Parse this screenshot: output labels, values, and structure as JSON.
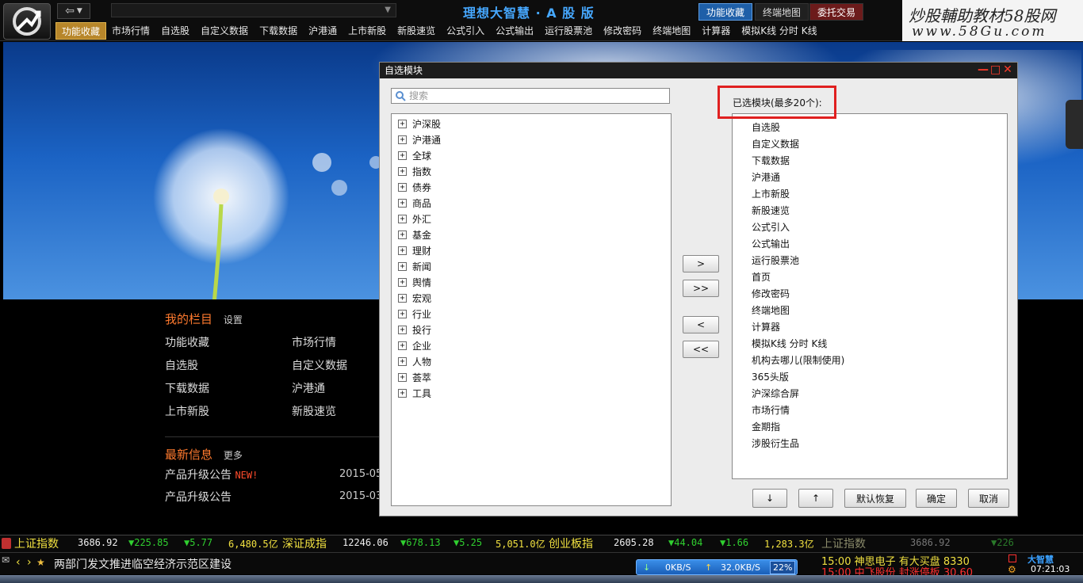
{
  "app": {
    "title": "理想大智慧 · A 股 版",
    "top_tabs": [
      "功能收藏",
      "终端地图",
      "委托交易"
    ]
  },
  "ad": {
    "line1": "炒股輔助教材58股网",
    "line2": "www.58Gu.com"
  },
  "menu": [
    "功能收藏",
    "市场行情",
    "自选股",
    "自定义数据",
    "下载数据",
    "沪港通",
    "上市新股",
    "新股速览",
    "公式引入",
    "公式输出",
    "运行股票池",
    "修改密码",
    "终端地图",
    "计算器",
    "模拟K线 分时 K线"
  ],
  "home": {
    "my_column": "我的栏目",
    "settings": "设置",
    "links": [
      "功能收藏",
      "市场行情",
      "自选股",
      "自定义数据",
      "下载数据",
      "沪港通",
      "上市新股",
      "新股速览"
    ],
    "news_header": "最新信息",
    "more": "更多",
    "news": [
      {
        "title": "产品升级公告",
        "tag": "NEW!",
        "date": "2015-05-"
      },
      {
        "title": "产品升级公告",
        "tag": "",
        "date": "2015-03-"
      }
    ]
  },
  "dialog": {
    "title": "自选模块",
    "search_placeholder": "搜索",
    "tree": [
      "沪深股",
      "沪港通",
      "全球",
      "指数",
      "债券",
      "商品",
      "外汇",
      "基金",
      "理财",
      "新闻",
      "舆情",
      "宏观",
      "行业",
      "投行",
      "企业",
      "人物",
      "荟萃",
      "工具"
    ],
    "mid_buttons": [
      ">",
      ">>",
      "<",
      "<<"
    ],
    "selected_label": "已选模块(最多20个):",
    "selected": [
      "自选股",
      "自定义数据",
      "下载数据",
      "沪港通",
      "上市新股",
      "新股速览",
      "公式引入",
      "公式输出",
      "运行股票池",
      "首页",
      "修改密码",
      "终端地图",
      "计算器",
      "模拟K线 分时 K线",
      "机构去哪儿(限制使用)",
      "365头版",
      "沪深综合屏",
      "市场行情",
      "金期指",
      "涉股衍生品"
    ],
    "bottom_buttons": [
      "↓",
      "↑",
      "默认恢复",
      "确定",
      "取消"
    ]
  },
  "ticker": {
    "sh_name": "上证指数",
    "sh_val": "3686.92",
    "sh_chg": "▼225.85",
    "sh_pct": "▼5.77",
    "sh_amt": "6,480.5亿",
    "sz_name": "深证成指",
    "sz_val": "12246.06",
    "sz_chg": "▼678.13",
    "sz_pct": "▼5.25",
    "sz_amt": "5,051.0亿",
    "cy_name": "创业板指",
    "cy_val": "2605.28",
    "cy_chg": "▼44.04",
    "cy_pct": "▼1.66",
    "cy_amt": "1,283.3亿",
    "right_name": "上证指数",
    "right_val": "3686.92",
    "right_chg": "▼226"
  },
  "status": {
    "news": "两部门发文推进临空经济示范区建设",
    "down_speed": "0KB/S",
    "up_speed": "32.0KB/S",
    "cpu": "22%",
    "alert1": "15:00 神思电子 有大买盘 8330",
    "alert2": "15:00 中飞股份 封涨停板 30.60",
    "brand": "大智慧",
    "clock": "07:21:03"
  },
  "colors": {
    "accent": "#b7862a",
    "highlight_box": "#e02020",
    "title_blue": "#46a8ff",
    "down_green": "#30d030"
  }
}
